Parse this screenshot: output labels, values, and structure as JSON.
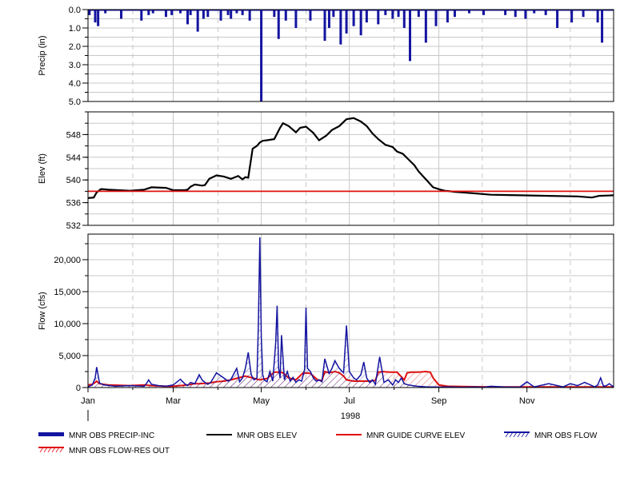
{
  "chart_data": [
    {
      "panel": "precip",
      "type": "bar",
      "ylabel": "Precip (in)",
      "ylim": [
        0,
        5
      ],
      "y_inverted": true,
      "y_ticks": [
        "0.0",
        "1.0",
        "2.0",
        "3.0",
        "4.0",
        "5.0"
      ],
      "x_range": [
        1,
        365
      ],
      "color": "#1414a0",
      "series": [
        {
          "name": "MNR OBS PRECIP-INC",
          "x": [
            2,
            6,
            8,
            13,
            24,
            38,
            43,
            46,
            55,
            59,
            65,
            70,
            72,
            77,
            81,
            84,
            93,
            98,
            100,
            104,
            108,
            113,
            121,
            130,
            133,
            138,
            145,
            155,
            165,
            168,
            171,
            176,
            180,
            185,
            190,
            194,
            202,
            207,
            212,
            216,
            220,
            224,
            230,
            235,
            242,
            250,
            255,
            265,
            275,
            290,
            297,
            304,
            310,
            318,
            326,
            336,
            344,
            354,
            357
          ],
          "values": [
            0.3,
            0.7,
            0.9,
            0.2,
            0.5,
            0.6,
            0.3,
            0.2,
            0.4,
            0.3,
            0.2,
            0.8,
            0.3,
            1.2,
            0.5,
            0.4,
            0.6,
            0.3,
            0.5,
            0.2,
            0.3,
            0.6,
            5.0,
            0.4,
            1.6,
            0.6,
            1.0,
            0.6,
            1.7,
            1.0,
            0.4,
            1.9,
            1.3,
            0.9,
            1.4,
            0.7,
            0.8,
            0.3,
            0.5,
            0.4,
            1.0,
            2.8,
            0.4,
            1.8,
            0.9,
            0.7,
            0.4,
            0.2,
            0.3,
            0.3,
            0.4,
            0.5,
            0.2,
            0.3,
            1.0,
            0.7,
            0.4,
            0.7,
            1.8
          ]
        }
      ]
    },
    {
      "panel": "elev",
      "type": "line",
      "ylabel": "Elev (ft)",
      "ylim": [
        532,
        552
      ],
      "y_ticks": [
        "532",
        "536",
        "540",
        "544",
        "548"
      ],
      "x_range": [
        1,
        365
      ],
      "series": [
        {
          "name": "MNR OBS ELEV",
          "color": "#000000",
          "x": [
            1,
            5,
            7,
            10,
            15,
            30,
            40,
            45,
            55,
            60,
            68,
            70,
            72,
            75,
            80,
            82,
            85,
            90,
            95,
            100,
            105,
            108,
            110,
            112,
            115,
            118,
            120,
            122,
            125,
            130,
            134,
            136,
            140,
            145,
            148,
            152,
            157,
            161,
            166,
            170,
            175,
            180,
            185,
            190,
            194,
            198,
            202,
            207,
            212,
            215,
            219,
            223,
            227,
            230,
            235,
            240,
            245,
            248,
            252,
            255,
            260,
            270,
            280,
            300,
            320,
            340,
            350,
            355,
            365
          ],
          "values": [
            536.8,
            536.9,
            537.8,
            538.4,
            538.3,
            538.1,
            538.3,
            538.7,
            538.6,
            538.2,
            538.2,
            538.3,
            538.8,
            539.2,
            539.0,
            539.1,
            540.2,
            540.8,
            540.6,
            540.2,
            540.7,
            540.1,
            540.5,
            540.4,
            545.5,
            546.0,
            546.6,
            546.9,
            547.0,
            547.2,
            549.2,
            550.0,
            549.5,
            548.4,
            549.2,
            549.4,
            548.3,
            547.0,
            547.8,
            548.8,
            549.5,
            550.7,
            550.9,
            550.3,
            549.5,
            548.2,
            547.2,
            546.2,
            545.8,
            545.0,
            544.6,
            543.6,
            542.6,
            541.5,
            540.1,
            538.7,
            538.3,
            538.1,
            538.0,
            537.9,
            537.8,
            537.6,
            537.4,
            537.3,
            537.2,
            537.1,
            536.9,
            537.2,
            537.3
          ]
        },
        {
          "name": "MNR GUIDE CURVE ELEV",
          "color": "#e01010",
          "x": [
            1,
            365
          ],
          "values": [
            538.0,
            538.0
          ]
        }
      ]
    },
    {
      "panel": "flow",
      "type": "line",
      "ylabel": "Flow (cfs)",
      "ylim": [
        0,
        24000
      ],
      "y_ticks": [
        "0",
        "5,000",
        "10,000",
        "15,000",
        "20,000"
      ],
      "x_range": [
        1,
        365
      ],
      "x_ticks": [
        "Jan",
        "Mar",
        "May",
        "Jul",
        "Sep",
        "Nov"
      ],
      "x_tick_days": [
        1,
        60,
        121,
        182,
        244,
        305
      ],
      "year_label": "1998",
      "series": [
        {
          "name": "MNR OBS FLOW",
          "color": "#1414a0",
          "x": [
            1,
            4,
            6,
            7,
            9,
            12,
            20,
            30,
            40,
            42,
            43,
            45,
            50,
            55,
            60,
            65,
            68,
            70,
            72,
            75,
            78,
            80,
            82,
            84,
            86,
            90,
            95,
            98,
            100,
            104,
            106,
            108,
            110,
            112,
            114,
            116,
            118,
            119,
            120,
            121,
            122,
            123,
            125,
            127,
            129,
            131,
            132,
            133,
            134,
            135,
            137,
            139,
            141,
            143,
            145,
            147,
            149,
            151,
            152,
            153,
            155,
            157,
            159,
            161,
            163,
            165,
            168,
            170,
            172,
            175,
            178,
            180,
            182,
            185,
            187,
            190,
            192,
            194,
            196,
            198,
            200,
            203,
            206,
            209,
            212,
            214,
            216,
            218,
            220,
            223,
            226,
            229,
            232,
            236,
            240,
            244,
            250,
            260,
            270,
            275,
            280,
            290,
            300,
            305,
            310,
            320,
            328,
            330,
            335,
            340,
            345,
            352,
            354,
            356,
            358,
            360,
            362,
            365
          ],
          "values": [
            100,
            400,
            1500,
            3200,
            700,
            400,
            200,
            300,
            200,
            800,
            1200,
            500,
            300,
            200,
            400,
            1300,
            600,
            300,
            800,
            600,
            2000,
            1200,
            800,
            500,
            800,
            2300,
            1500,
            1000,
            1300,
            3000,
            900,
            1500,
            3000,
            5500,
            2000,
            1200,
            1500,
            10000,
            23500,
            8000,
            2000,
            1200,
            900,
            2500,
            1000,
            7000,
            12800,
            3000,
            1500,
            8200,
            1200,
            2500,
            1000,
            1600,
            800,
            1200,
            1000,
            2800,
            12500,
            3000,
            2500,
            1500,
            1000,
            1200,
            900,
            4500,
            2200,
            3000,
            4200,
            3000,
            2300,
            9700,
            2500,
            1500,
            1200,
            2000,
            4000,
            1500,
            800,
            1200,
            500,
            4800,
            800,
            1200,
            400,
            1200,
            800,
            1500,
            600,
            400,
            300,
            200,
            150,
            100,
            100,
            80,
            100,
            50,
            100,
            30,
            200,
            80,
            60,
            900,
            100,
            600,
            200,
            100,
            600,
            300,
            800,
            100,
            400,
            1500,
            200,
            300,
            600,
            100
          ]
        },
        {
          "name": "MNR OBS FLOW-RES OUT",
          "color": "#e01010",
          "x": [
            1,
            4,
            6,
            7,
            9,
            15,
            30,
            40,
            45,
            55,
            60,
            70,
            75,
            78,
            85,
            90,
            95,
            100,
            105,
            110,
            115,
            118,
            120,
            122,
            125,
            128,
            130,
            134,
            136,
            140,
            145,
            150,
            155,
            160,
            163,
            165,
            168,
            170,
            172,
            175,
            178,
            180,
            185,
            190,
            195,
            200,
            202,
            205,
            210,
            215,
            220,
            222,
            225,
            230,
            235,
            238,
            240,
            244,
            250,
            260,
            280,
            300,
            320,
            340,
            360,
            365
          ],
          "values": [
            400,
            500,
            800,
            1000,
            600,
            400,
            300,
            400,
            300,
            200,
            200,
            400,
            600,
            600,
            700,
            900,
            1000,
            1200,
            1500,
            1800,
            1500,
            1300,
            1200,
            1300,
            1400,
            2000,
            2400,
            2400,
            2300,
            1500,
            1200,
            2300,
            2200,
            1200,
            1100,
            2500,
            2300,
            2400,
            2500,
            2300,
            1800,
            1200,
            1000,
            1000,
            1000,
            1100,
            2400,
            2500,
            2400,
            2400,
            1200,
            2300,
            2400,
            2400,
            2500,
            2400,
            1500,
            400,
            200,
            150,
            100,
            100,
            100,
            100,
            100,
            100
          ]
        }
      ]
    }
  ],
  "legend": [
    {
      "label": "MNR OBS PRECIP-INC",
      "style": "thick-bar",
      "color": "#1414a0"
    },
    {
      "label": "MNR OBS ELEV",
      "style": "line",
      "color": "#000000"
    },
    {
      "label": "MNR GUIDE CURVE ELEV",
      "style": "line",
      "color": "#e01010"
    },
    {
      "label": "MNR OBS FLOW",
      "style": "hatch",
      "color": "#1414a0"
    },
    {
      "label": "MNR OBS FLOW-RES OUT",
      "style": "hatch",
      "color": "#e01010"
    }
  ]
}
